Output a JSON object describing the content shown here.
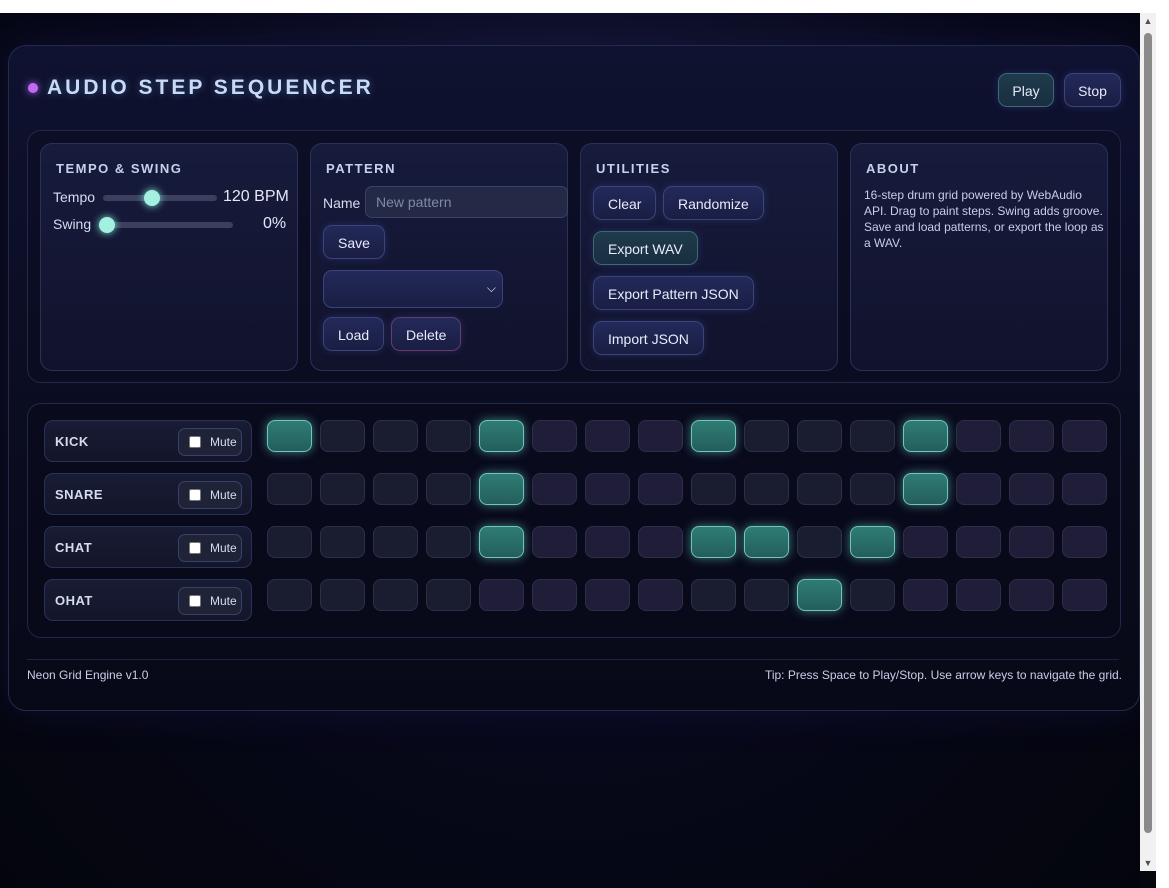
{
  "app": {
    "title": "AUDIO STEP SEQUENCER"
  },
  "transport": {
    "play": "Play",
    "stop": "Stop"
  },
  "tempo": {
    "title": "TEMPO & SWING",
    "tempo_label": "Tempo",
    "tempo_value": "120 BPM",
    "tempo_level": 0.42,
    "swing_label": "Swing",
    "swing_value": "0%",
    "swing_level": 0.0
  },
  "pattern": {
    "title": "PATTERN",
    "name_label": "Name",
    "name_placeholder": "New pattern",
    "save": "Save",
    "load": "Load",
    "delete": "Delete",
    "selected": ""
  },
  "utilities": {
    "title": "UTILITIES",
    "clear": "Clear",
    "randomize": "Randomize",
    "export_wav": "Export WAV",
    "export_json": "Export Pattern JSON",
    "import_json": "Import JSON"
  },
  "about": {
    "title": "ABOUT",
    "text": "16-step drum grid powered by WebAudio API. Drag to paint steps. Swing adds groove. Save and load patterns, or export the loop as a WAV."
  },
  "tracks": [
    {
      "name": "KICK",
      "mute_label": "Mute",
      "muted": false,
      "steps": [
        1,
        0,
        0,
        0,
        1,
        0,
        0,
        0,
        1,
        0,
        0,
        0,
        1,
        0,
        0,
        0
      ]
    },
    {
      "name": "SNARE",
      "mute_label": "Mute",
      "muted": false,
      "steps": [
        0,
        0,
        0,
        0,
        1,
        0,
        0,
        0,
        0,
        0,
        0,
        0,
        1,
        0,
        0,
        0
      ]
    },
    {
      "name": "CHAT",
      "mute_label": "Mute",
      "muted": false,
      "steps": [
        0,
        0,
        0,
        0,
        1,
        0,
        0,
        0,
        1,
        1,
        0,
        1,
        0,
        0,
        0,
        0
      ]
    },
    {
      "name": "OHAT",
      "mute_label": "Mute",
      "muted": false,
      "steps": [
        0,
        0,
        0,
        0,
        0,
        0,
        0,
        0,
        0,
        0,
        1,
        0,
        0,
        0,
        0,
        0
      ]
    }
  ],
  "footer": {
    "left": "Neon Grid Engine v1.0",
    "right": "Tip: Press Space to Play/Stop. Use arrow keys to navigate the grid."
  },
  "colors": {
    "accent": "#a4f0e0",
    "step_on": "#2f7d74",
    "dot": "#c06af0"
  }
}
